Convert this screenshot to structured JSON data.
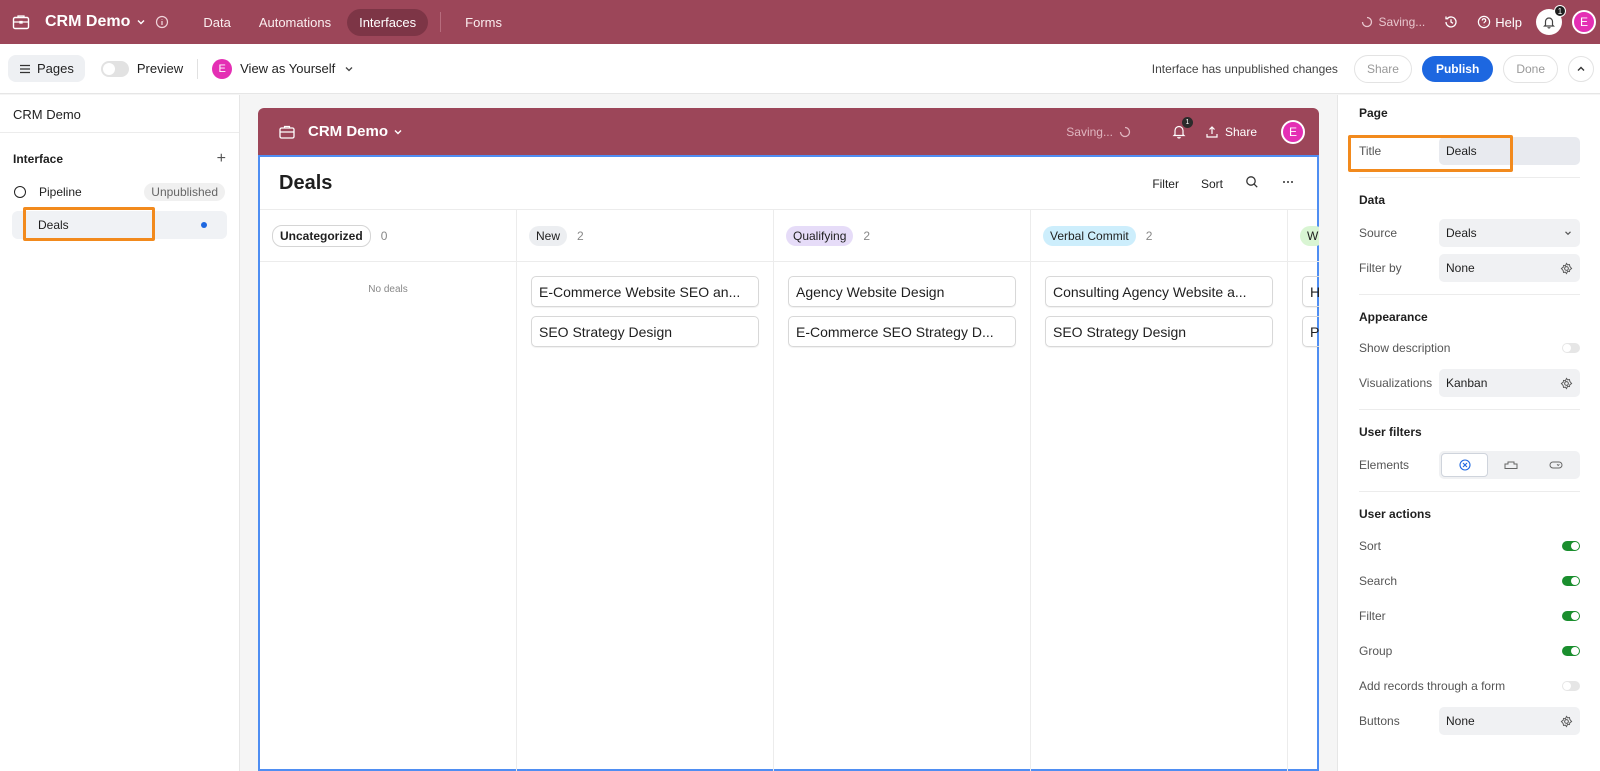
{
  "topbar": {
    "base_name": "CRM Demo",
    "nav": [
      "Data",
      "Automations",
      "Interfaces",
      "Forms"
    ],
    "saving": "Saving...",
    "help": "Help",
    "notif_count": "1",
    "avatar": "E"
  },
  "toolbar": {
    "pages": "Pages",
    "preview": "Preview",
    "view_as": "View as Yourself",
    "avatar": "E",
    "unpublished_msg": "Interface has unpublished changes",
    "share": "Share",
    "publish": "Publish",
    "done": "Done"
  },
  "sidebar": {
    "title": "CRM Demo",
    "section": "Interface",
    "pages": [
      {
        "label": "Pipeline",
        "status": "Unpublished"
      },
      {
        "label": "Deals"
      }
    ]
  },
  "interface": {
    "name": "CRM Demo",
    "saving": "Saving...",
    "notif_count": "1",
    "share": "Share",
    "avatar": "E",
    "page_title": "Deals",
    "tools": {
      "filter": "Filter",
      "sort": "Sort"
    },
    "columns": [
      {
        "name": "Uncategorized",
        "count": "0",
        "empty_text": "No deals",
        "cards": []
      },
      {
        "name": "New",
        "count": "2",
        "cards": [
          "E-Commerce Website SEO an...",
          "SEO Strategy Design"
        ]
      },
      {
        "name": "Qualifying",
        "count": "2",
        "cards": [
          "Agency Website Design",
          "E-Commerce SEO Strategy D..."
        ]
      },
      {
        "name": "Verbal Commit",
        "count": "2",
        "cards": [
          "Consulting Agency Website a...",
          "SEO Strategy Design"
        ]
      },
      {
        "name": "W",
        "count": "",
        "cards": [
          "H",
          "P"
        ]
      }
    ]
  },
  "panel": {
    "page_heading": "Page",
    "title_label": "Title",
    "title_value": "Deals",
    "data_heading": "Data",
    "source_label": "Source",
    "source_value": "Deals",
    "filter_by_label": "Filter by",
    "filter_by_value": "None",
    "appearance_heading": "Appearance",
    "show_description_label": "Show description",
    "visualizations_label": "Visualizations",
    "visualizations_value": "Kanban",
    "user_filters_heading": "User filters",
    "elements_label": "Elements",
    "user_actions_heading": "User actions",
    "actions": [
      {
        "label": "Sort",
        "on": true
      },
      {
        "label": "Search",
        "on": true
      },
      {
        "label": "Filter",
        "on": true
      },
      {
        "label": "Group",
        "on": true
      },
      {
        "label": "Add records through a form",
        "on": false
      }
    ],
    "buttons_label": "Buttons",
    "buttons_value": "None"
  },
  "colors": {
    "brand": "#9c4659",
    "accent": "#1d67e0",
    "highlight": "#f28a1d",
    "toggle_on": "#1a8e2e",
    "avatar": "#e42fb4",
    "tag_new": "#eceef1",
    "tag_qualifying": "#e6dcf8",
    "tag_verbal": "#cdeefc",
    "tag_won": "#d9f5d3"
  }
}
